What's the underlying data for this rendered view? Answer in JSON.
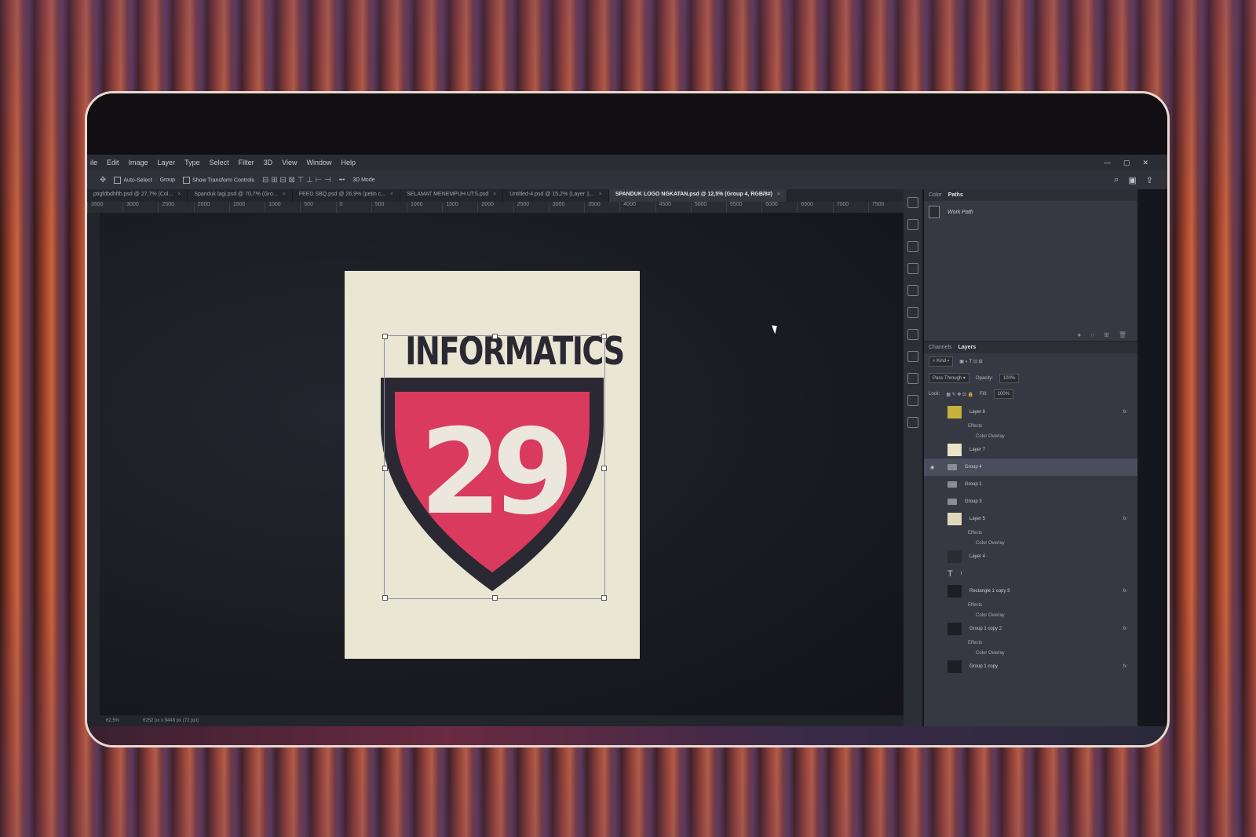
{
  "menu": {
    "items": [
      "ile",
      "Edit",
      "Image",
      "Layer",
      "Type",
      "Select",
      "Filter",
      "3D",
      "View",
      "Window",
      "Help"
    ]
  },
  "options": {
    "auto_select": "Auto-Select",
    "group": "Group",
    "transform_controls": "Show Transform Controls",
    "mode_3d": "3D Mode"
  },
  "tabs": [
    {
      "label": "ptigfdbdhfth.psd @ 27,7% (Col...",
      "active": false
    },
    {
      "label": "Spanduk lagi.psd @ 70,7% (Gro...",
      "active": false
    },
    {
      "label": "FEED SBQ.psd @ 26,9% (petin c...",
      "active": false
    },
    {
      "label": "SELAMAT MENEMPUH UTS.psd",
      "active": false
    },
    {
      "label": "Untitled-4.psd @ 15,2% (Layer 1...",
      "active": false
    },
    {
      "label": "SPANDUK LOGO NGKATAN.psd @ 12,5% (Group 4, RGB/8#)",
      "active": true
    }
  ],
  "ruler": [
    "3500",
    "3000",
    "2500",
    "2000",
    "1500",
    "1000",
    "500",
    "0",
    "500",
    "1000",
    "1500",
    "2000",
    "2500",
    "3000",
    "3500",
    "4000",
    "4500",
    "5000",
    "5500",
    "6000",
    "6500",
    "7000",
    "7500"
  ],
  "artwork": {
    "title": "INFORMATICS",
    "number": "29",
    "shield_color": "#d93a5e",
    "text_color": "#2a2832"
  },
  "status": {
    "zoom": "62,5%",
    "size": "6252 px x 9448 px (72 ppi)"
  },
  "paths_panel": {
    "tabs": [
      "Color",
      "Paths"
    ],
    "active": "Paths",
    "path_name": "Work Path"
  },
  "layers_panel": {
    "tabs": [
      "Channels",
      "Layers"
    ],
    "active": "Layers",
    "filter": "Kind",
    "blend_mode": "Pass Through",
    "opacity_label": "Opacity:",
    "opacity": "100%",
    "lock_label": "Lock:",
    "fill_label": "Fill:",
    "fill": "100%",
    "layers": [
      {
        "name": "Layer 8",
        "type": "layer",
        "fx": true
      },
      {
        "name": "Effects",
        "type": "sub"
      },
      {
        "name": "Color Overlay",
        "type": "sub2"
      },
      {
        "name": "Layer 7",
        "type": "layer"
      },
      {
        "name": "Group 4",
        "type": "group",
        "selected": true
      },
      {
        "name": "Group 1",
        "type": "group"
      },
      {
        "name": "Group 3",
        "type": "group"
      },
      {
        "name": "Layer 5",
        "type": "layer",
        "fx": true
      },
      {
        "name": "Effects",
        "type": "sub"
      },
      {
        "name": "Color Overlay",
        "type": "sub2"
      },
      {
        "name": "Layer 4",
        "type": "layer"
      },
      {
        "name": "I",
        "type": "text"
      },
      {
        "name": "Rectangle 1 copy 3",
        "type": "layer",
        "fx": true
      },
      {
        "name": "Effects",
        "type": "sub"
      },
      {
        "name": "Color Overlay",
        "type": "sub2"
      },
      {
        "name": "Group 1 copy 2",
        "type": "layer",
        "fx": true
      },
      {
        "name": "Effects",
        "type": "sub"
      },
      {
        "name": "Color Overlay",
        "type": "sub2"
      },
      {
        "name": "Group 1 copy",
        "type": "layer",
        "fx": true
      }
    ]
  }
}
